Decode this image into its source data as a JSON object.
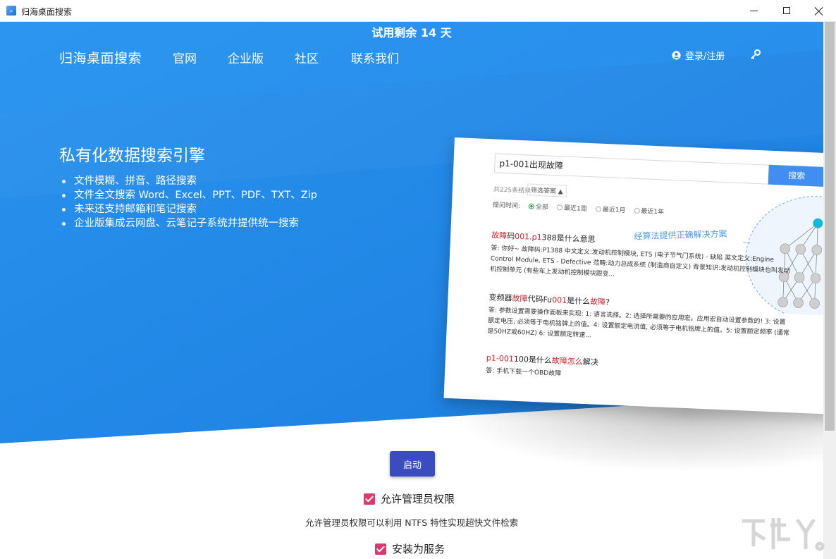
{
  "window": {
    "title": "归海桌面搜索"
  },
  "trial_text": "试用剩余 14 天",
  "nav": {
    "brand": "归海桌面搜索",
    "links": [
      "官网",
      "企业版",
      "社区",
      "联系我们"
    ],
    "login": "登录/注册"
  },
  "hero": {
    "headline": "私有化数据搜索引擎",
    "features": [
      "文件模糊、拼音、路径搜索",
      "文件全文搜索 Word、Excel、PPT、PDF、TXT、Zip",
      "未来还支持邮箱和笔记搜索",
      "企业版集成云网盘、云笔记子系统并提供统一搜索"
    ]
  },
  "demo": {
    "query": "p1-001出现故障",
    "search_btn": "搜索",
    "result_count": "共225条结果",
    "filter": "筛选答案 ▲",
    "time_label": "提问时间:",
    "time_options": [
      "全部",
      "最近1周",
      "最近1月",
      "最近1年"
    ],
    "algo_label": "经算法提供正确解决方案",
    "results": [
      {
        "title_parts": [
          {
            "t": "故障",
            "hl": true
          },
          {
            "t": "码",
            "hl": false
          },
          {
            "t": "001.p1",
            "hl": true
          },
          {
            "t": "388是什么意思",
            "hl": false
          }
        ],
        "answer": "答: 你好~ 故障码:P1388 中文定义:发动机控制模块, ETS (电子节气门系统) - 缺陷 英文定义:Engine Control Module, ETS - Defective 范畴:动力总成系统 (制造商自定义) 背景知识:发动机控制模块也叫发动机控制单元 (有些车上发动机控制模块跟变..."
      },
      {
        "title_parts": [
          {
            "t": "变频器",
            "hl": false
          },
          {
            "t": "故障",
            "hl": true
          },
          {
            "t": "代码Fu",
            "hl": false
          },
          {
            "t": "001",
            "hl": true
          },
          {
            "t": "是什么",
            "hl": false
          },
          {
            "t": "故障",
            "hl": true
          },
          {
            "t": "?",
            "hl": false
          }
        ],
        "answer": "答: 参数设置需要操作面板来实现: 1: 语言选择。2: 选择所需要的应用宏。应用宏自动设置参数的! 3: 设置额定电压, 必须等于电机铭牌上的值。4: 设置额定电流值, 必须等于电机铭牌上的值。5: 设置额定频率 (通常是50HZ或60HZ) 6: 设置额定转速..."
      },
      {
        "title_parts": [
          {
            "t": "p1-001",
            "hl": true
          },
          {
            "t": "100是什么",
            "hl": false
          },
          {
            "t": "故障怎么",
            "hl": true
          },
          {
            "t": "解决",
            "hl": false
          }
        ],
        "answer": "答: 手机下载一个OBD故障"
      }
    ]
  },
  "actions": {
    "start": "启动",
    "admin_checkbox": "允许管理员权限",
    "admin_desc": "允许管理员权限可以利用 NTFS 特性实现超快文件检索",
    "service_checkbox": "安装为服务"
  },
  "colors": {
    "hero_blue": "#1f87e8",
    "hero_blue_dark": "#1a78dc",
    "start_button": "#3b4cc0",
    "checkbox": "#d83a6b",
    "highlight_red": "#d0202a"
  }
}
